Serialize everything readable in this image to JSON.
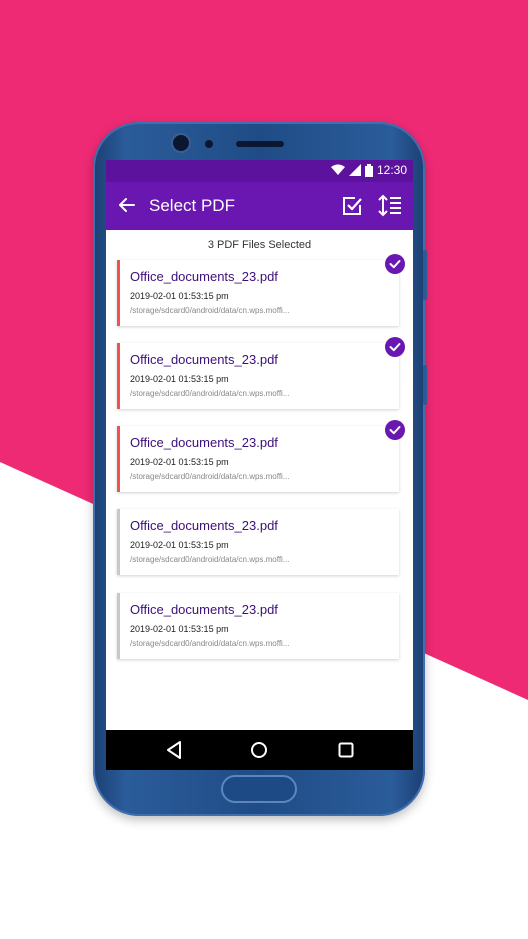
{
  "status_bar": {
    "time": "12:30"
  },
  "app_bar": {
    "title": "Select PDF",
    "back_icon": "arrow-back-icon",
    "select_all_icon": "checkbox-checked-icon",
    "sort_icon": "sort-icon"
  },
  "selection": {
    "count_text": "3 PDF Files Selected"
  },
  "files": [
    {
      "name": "Office_documents_23.pdf",
      "date": "2019-02-01 01:53:15 pm",
      "path": "/storage/sdcard0/android/data/cn.wps.moffi...",
      "selected": true
    },
    {
      "name": "Office_documents_23.pdf",
      "date": "2019-02-01 01:53:15 pm",
      "path": "/storage/sdcard0/android/data/cn.wps.moffi...",
      "selected": true
    },
    {
      "name": "Office_documents_23.pdf",
      "date": "2019-02-01 01:53:15 pm",
      "path": "/storage/sdcard0/android/data/cn.wps.moffi...",
      "selected": true
    },
    {
      "name": "Office_documents_23.pdf",
      "date": "2019-02-01 01:53:15 pm",
      "path": "/storage/sdcard0/android/data/cn.wps.moffi...",
      "selected": false
    },
    {
      "name": "Office_documents_23.pdf",
      "date": "2019-02-01 01:53:15 pm",
      "path": "/storage/sdcard0/android/data/cn.wps.moffi...",
      "selected": false
    }
  ],
  "colors": {
    "accent": "#6a16b0",
    "status_bar": "#5d129e",
    "background_pink": "#ee2a74",
    "selected_bar": "#ef5350",
    "unselected_bar": "#c8c8c8"
  }
}
